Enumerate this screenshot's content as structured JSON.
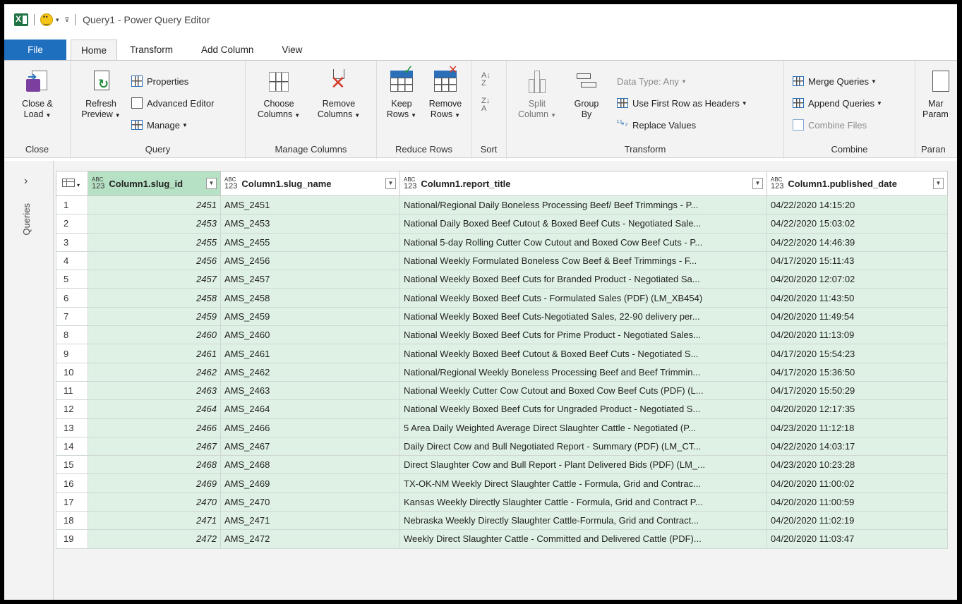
{
  "window": {
    "title": "Query1 - Power Query Editor"
  },
  "tabs": [
    "File",
    "Home",
    "Transform",
    "Add Column",
    "View"
  ],
  "ribbon": {
    "close": {
      "group": "Close",
      "close_load": "Close &",
      "close_load2": "Load"
    },
    "query": {
      "group": "Query",
      "refresh": "Refresh",
      "refresh2": "Preview",
      "properties": "Properties",
      "advanced": "Advanced Editor",
      "manage": "Manage"
    },
    "manage_columns": {
      "group": "Manage Columns",
      "choose": "Choose",
      "choose2": "Columns",
      "remove": "Remove",
      "remove2": "Columns"
    },
    "reduce_rows": {
      "group": "Reduce Rows",
      "keep": "Keep",
      "keep2": "Rows",
      "remove": "Remove",
      "remove2": "Rows"
    },
    "sort": {
      "group": "Sort"
    },
    "transform": {
      "group": "Transform",
      "split": "Split",
      "split2": "Column",
      "groupby": "Group",
      "groupby2": "By",
      "datatype": "Data Type: Any",
      "first_row": "Use First Row as Headers",
      "replace": "Replace Values"
    },
    "combine": {
      "group": "Combine",
      "merge": "Merge Queries",
      "append": "Append Queries",
      "files": "Combine Files"
    },
    "params": {
      "group": "Paran",
      "manage": "Mar",
      "manage2": "Param"
    }
  },
  "queries_panel": {
    "label": "Queries"
  },
  "columns": [
    "Column1.slug_id",
    "Column1.slug_name",
    "Column1.report_title",
    "Column1.published_date"
  ],
  "rows": [
    [
      "1",
      "2451",
      "AMS_2451",
      "National/Regional Daily Boneless Processing Beef/ Beef Trimmings - P...",
      "04/22/2020 14:15:20"
    ],
    [
      "2",
      "2453",
      "AMS_2453",
      "National Daily Boxed Beef Cutout & Boxed Beef Cuts - Negotiated Sale...",
      "04/22/2020 15:03:02"
    ],
    [
      "3",
      "2455",
      "AMS_2455",
      "National 5-day Rolling Cutter Cow Cutout and Boxed Cow Beef Cuts - P...",
      "04/22/2020 14:46:39"
    ],
    [
      "4",
      "2456",
      "AMS_2456",
      "National Weekly Formulated Boneless Cow Beef & Beef Trimmings - F...",
      "04/17/2020 15:11:43"
    ],
    [
      "5",
      "2457",
      "AMS_2457",
      "National Weekly Boxed Beef Cuts for Branded Product - Negotiated Sa...",
      "04/20/2020 12:07:02"
    ],
    [
      "6",
      "2458",
      "AMS_2458",
      "National Weekly Boxed Beef Cuts - Formulated Sales (PDF) (LM_XB454)",
      "04/20/2020 11:43:50"
    ],
    [
      "7",
      "2459",
      "AMS_2459",
      "National Weekly Boxed Beef Cuts-Negotiated Sales, 22-90 delivery per...",
      "04/20/2020 11:49:54"
    ],
    [
      "8",
      "2460",
      "AMS_2460",
      "National Weekly Boxed Beef Cuts for Prime Product - Negotiated Sales...",
      "04/20/2020 11:13:09"
    ],
    [
      "9",
      "2461",
      "AMS_2461",
      "National Weekly Boxed Beef Cutout & Boxed Beef Cuts - Negotiated S...",
      "04/17/2020 15:54:23"
    ],
    [
      "10",
      "2462",
      "AMS_2462",
      "National/Regional Weekly Boneless Processing Beef and Beef Trimmin...",
      "04/17/2020 15:36:50"
    ],
    [
      "11",
      "2463",
      "AMS_2463",
      "National Weekly Cutter Cow Cutout and Boxed Cow Beef Cuts (PDF) (L...",
      "04/17/2020 15:50:29"
    ],
    [
      "12",
      "2464",
      "AMS_2464",
      "National Weekly Boxed Beef Cuts for Ungraded Product - Negotiated S...",
      "04/20/2020 12:17:35"
    ],
    [
      "13",
      "2466",
      "AMS_2466",
      "5 Area Daily Weighted Average Direct Slaughter Cattle - Negotiated (P...",
      "04/23/2020 11:12:18"
    ],
    [
      "14",
      "2467",
      "AMS_2467",
      "Daily Direct Cow and Bull Negotiated Report - Summary (PDF) (LM_CT...",
      "04/22/2020 14:03:17"
    ],
    [
      "15",
      "2468",
      "AMS_2468",
      "Direct Slaughter Cow and Bull Report - Plant Delivered Bids (PDF) (LM_...",
      "04/23/2020 10:23:28"
    ],
    [
      "16",
      "2469",
      "AMS_2469",
      "TX-OK-NM Weekly Direct Slaughter Cattle - Formula, Grid and Contrac...",
      "04/20/2020 11:00:02"
    ],
    [
      "17",
      "2470",
      "AMS_2470",
      "Kansas Weekly Directly Slaughter Cattle - Formula, Grid and Contract P...",
      "04/20/2020 11:00:59"
    ],
    [
      "18",
      "2471",
      "AMS_2471",
      "Nebraska Weekly Directly Slaughter Cattle-Formula, Grid and Contract...",
      "04/20/2020 11:02:19"
    ],
    [
      "19",
      "2472",
      "AMS_2472",
      "Weekly Direct Slaughter Cattle - Committed and Delivered Cattle (PDF)...",
      "04/20/2020 11:03:47"
    ]
  ],
  "type_badge": {
    "top": "ABC",
    "bottom": "123"
  },
  "colors": {
    "file_tab": "#1f6fbf",
    "selected_col": "#b7e1c4",
    "cell_bg": "#dff1e4",
    "excel": "#1f7244"
  }
}
